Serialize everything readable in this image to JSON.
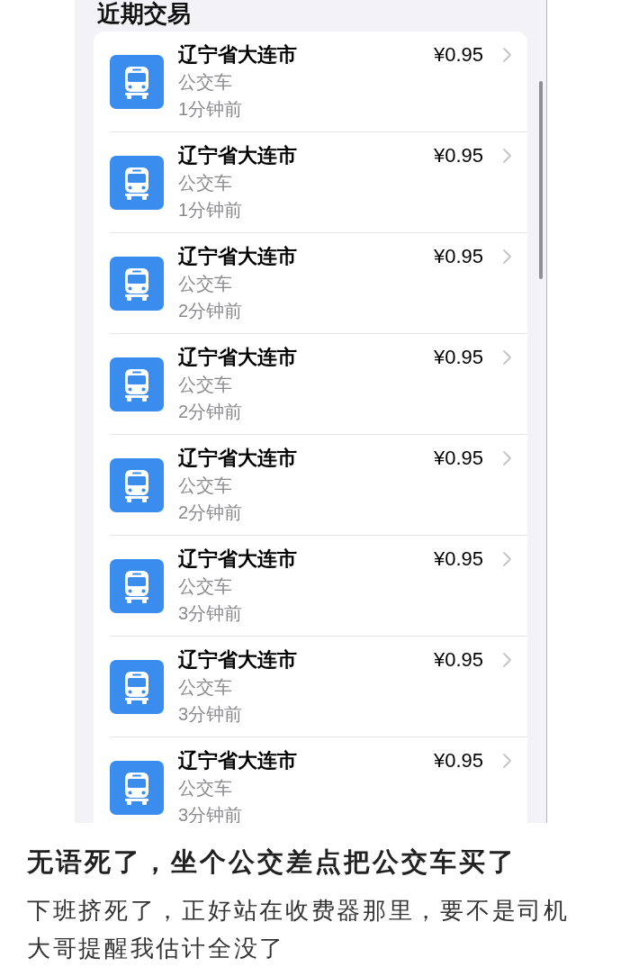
{
  "screenshot": {
    "section_title": "近期交易",
    "transactions": [
      {
        "merchant": "辽宁省大连市",
        "category": "公交车",
        "time": "1分钟前",
        "amount": "¥0.95"
      },
      {
        "merchant": "辽宁省大连市",
        "category": "公交车",
        "time": "1分钟前",
        "amount": "¥0.95"
      },
      {
        "merchant": "辽宁省大连市",
        "category": "公交车",
        "time": "2分钟前",
        "amount": "¥0.95"
      },
      {
        "merchant": "辽宁省大连市",
        "category": "公交车",
        "time": "2分钟前",
        "amount": "¥0.95"
      },
      {
        "merchant": "辽宁省大连市",
        "category": "公交车",
        "time": "2分钟前",
        "amount": "¥0.95"
      },
      {
        "merchant": "辽宁省大连市",
        "category": "公交车",
        "time": "3分钟前",
        "amount": "¥0.95"
      },
      {
        "merchant": "辽宁省大连市",
        "category": "公交车",
        "time": "3分钟前",
        "amount": "¥0.95"
      },
      {
        "merchant": "辽宁省大连市",
        "category": "公交车",
        "time": "3分钟前",
        "amount": "¥0.95"
      }
    ]
  },
  "post": {
    "title": "无语死了，坐个公交差点把公交车买了",
    "body": "下班挤死了，正好站在收费器那里，要不是司机大哥提醒我估计全没了"
  }
}
